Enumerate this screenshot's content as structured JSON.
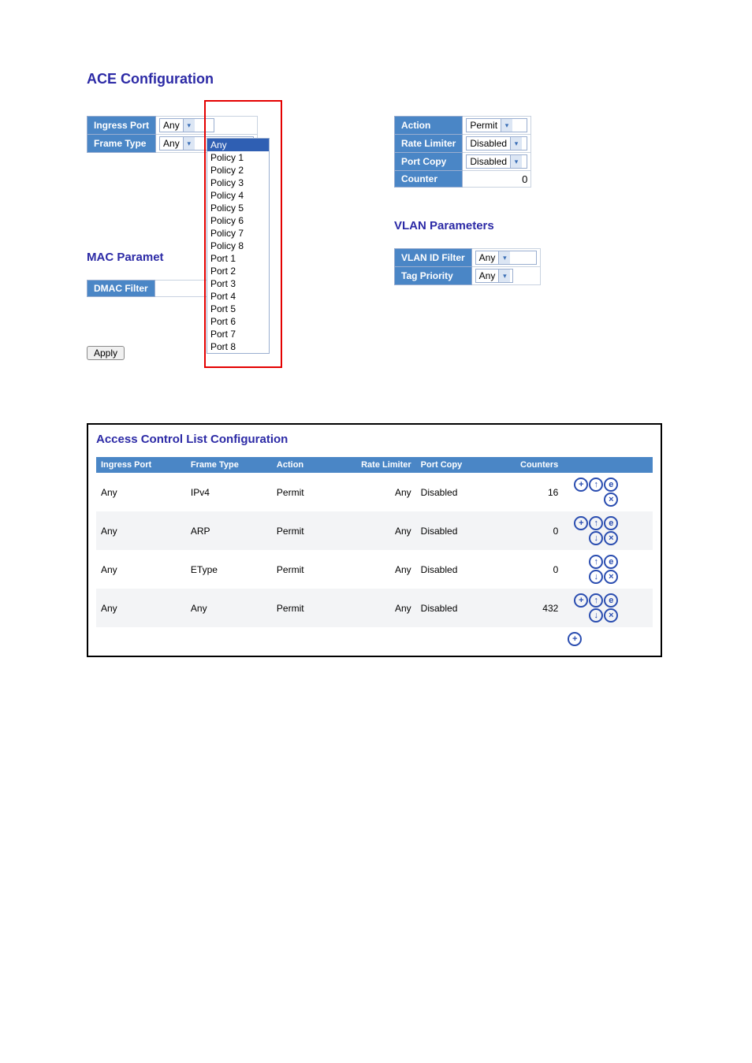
{
  "title": "ACE Configuration",
  "left": {
    "ingress_port": {
      "label": "Ingress Port",
      "value": "Any"
    },
    "frame_type": {
      "label": "Frame Type",
      "value": "Any"
    },
    "list_open": {
      "selected": "Any",
      "options": [
        "Any",
        "Policy 1",
        "Policy 2",
        "Policy 3",
        "Policy 4",
        "Policy 5",
        "Policy 6",
        "Policy 7",
        "Policy 8",
        "Port 1",
        "Port 2",
        "Port 3",
        "Port 4",
        "Port 5",
        "Port 6",
        "Port 7",
        "Port 8"
      ]
    },
    "mac_params_heading": "MAC Paramet",
    "dmac_filter_label": "DMAC Filter",
    "apply": "Apply"
  },
  "right_top": {
    "rows": [
      {
        "label": "Action",
        "value": "Permit",
        "has_dd": true
      },
      {
        "label": "Rate Limiter",
        "value": "Disabled",
        "has_dd": true
      },
      {
        "label": "Port Copy",
        "value": "Disabled",
        "has_dd": true
      },
      {
        "label": "Counter",
        "value": "0",
        "has_dd": false
      }
    ]
  },
  "vlan": {
    "heading": "VLAN Parameters",
    "rows": [
      {
        "label": "VLAN ID Filter",
        "value": "Any"
      },
      {
        "label": "Tag Priority",
        "value": "Any"
      }
    ]
  },
  "acl": {
    "title": "Access Control List Configuration",
    "headers": [
      "Ingress Port",
      "Frame Type",
      "Action",
      "Rate Limiter",
      "Port Copy",
      "Counters",
      ""
    ],
    "rows": [
      {
        "ingress": "Any",
        "ftype": "IPv4",
        "action": "Permit",
        "rl": "Any",
        "pc": "Disabled",
        "cnt": "16",
        "icons": [
          "plus",
          "up",
          "target",
          "",
          "delete"
        ]
      },
      {
        "ingress": "Any",
        "ftype": "ARP",
        "action": "Permit",
        "rl": "Any",
        "pc": "Disabled",
        "cnt": "0",
        "icons": [
          "plus",
          "up",
          "target",
          "down",
          "delete"
        ]
      },
      {
        "ingress": "Any",
        "ftype": "EType",
        "action": "Permit",
        "rl": "Any",
        "pc": "Disabled",
        "cnt": "0",
        "icons": [
          "",
          "up",
          "target",
          "down",
          "delete"
        ]
      },
      {
        "ingress": "Any",
        "ftype": "Any",
        "action": "Permit",
        "rl": "Any",
        "pc": "Disabled",
        "cnt": "432",
        "icons": [
          "plus",
          "up",
          "target",
          "down",
          "delete"
        ]
      }
    ],
    "footer_icons": [
      "plus"
    ]
  }
}
